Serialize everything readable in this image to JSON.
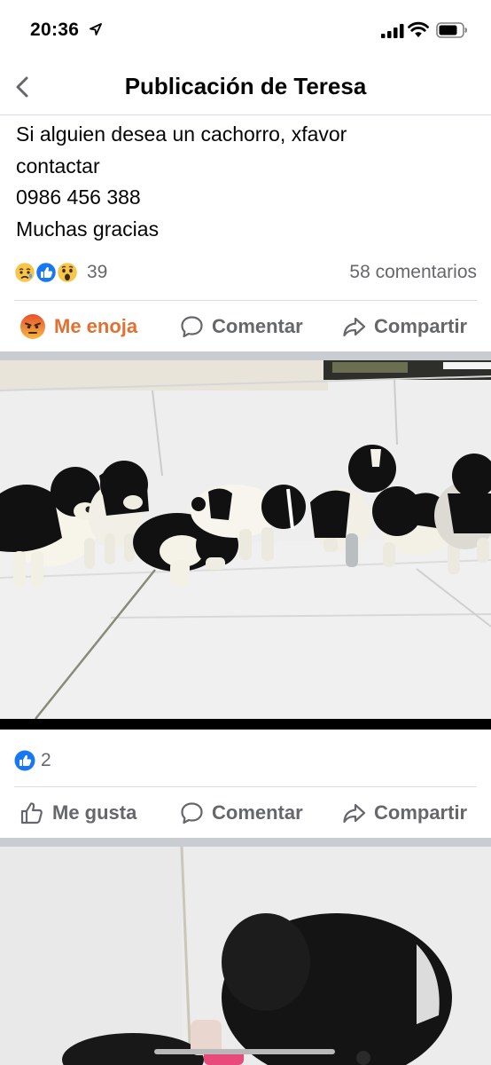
{
  "status_bar": {
    "time": "20:36",
    "icons": [
      "location-arrow-icon",
      "cellular-signal-icon",
      "wifi-icon",
      "battery-icon"
    ]
  },
  "header": {
    "title": "Publicación de Teresa",
    "back_icon": "chevron-left-icon"
  },
  "post": {
    "text_lines": [
      "Si alguien desea un cachorro, xfavor",
      "contactar",
      "0986 456 388",
      "Muchas gracias"
    ],
    "reactions": {
      "icons": [
        "sad-reaction-icon",
        "like-reaction-icon",
        "wow-reaction-icon"
      ],
      "count": "39"
    },
    "comments_count": "58 comentarios",
    "actions": {
      "react_label": "Me enoja",
      "comment_label": "Comentar",
      "share_label": "Compartir"
    }
  },
  "photo1": {
    "description_icon": "puppies-photo",
    "likes_count": "2",
    "actions": {
      "like_label": "Me gusta",
      "comment_label": "Comentar",
      "share_label": "Compartir"
    }
  },
  "colors": {
    "angry_orange": "#e17131",
    "secondary_text": "#65676b",
    "facebook_blue": "#1877f2",
    "separator": "#c9ccd1"
  }
}
